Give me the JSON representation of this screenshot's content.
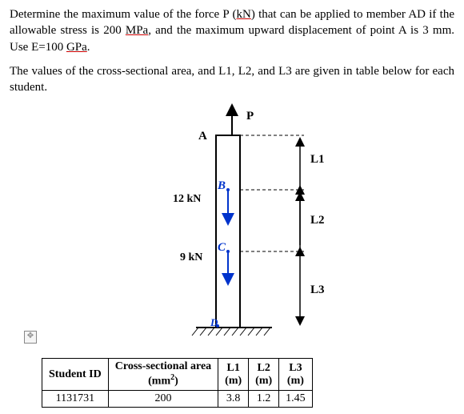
{
  "para1_a": "Determine the maximum value of the force P (",
  "para1_b": "kN",
  "para1_c": ") that can be applied to member AD if the allowable stress is 200 ",
  "para1_d": "MPa",
  "para1_e": ", and the maximum upward displacement of point A is 3 mm. Use E=100 ",
  "para1_f": "GPa",
  "para1_g": ".",
  "para2": "The values of the cross-sectional area, and L1, L2, and L3 are given in table below for each student.",
  "diagram": {
    "P": "P",
    "A": "A",
    "B": "B",
    "C": "C",
    "D": "D",
    "L1": "L1",
    "L2": "L2",
    "L3": "L3",
    "F12": "12 kN",
    "F9": "9 kN"
  },
  "table": {
    "h_student": "Student ID",
    "h_area_a": "Cross-sectional area",
    "h_area_b": "(mm",
    "h_area_c": ")",
    "h_L1": "L1",
    "h_L2": "L2",
    "h_L3": "L3",
    "h_m": "(m)",
    "row": {
      "id": "1131731",
      "area": "200",
      "L1": "3.8",
      "L2": "1.2",
      "L3": "1.45"
    }
  },
  "chart_data": {
    "type": "diagram",
    "description": "Vertical column AD fixed at D, upward force P at A, 12 kN at B, 9 kN at C; AB=L1, BC=L2, CD=L3",
    "forces": {
      "P_at_A": "up",
      "B": 12,
      "C": 9
    },
    "lengths": {
      "L1": 3.8,
      "L2": 1.2,
      "L3": 1.45,
      "unit": "m"
    },
    "area_mm2": 200,
    "E_GPa": 100,
    "sigma_allow_MPa": 200,
    "delta_A_max_mm": 3
  }
}
